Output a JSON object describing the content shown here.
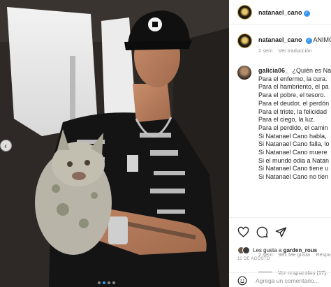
{
  "post": {
    "author": "natanael_cano",
    "verified_icon": "verified-check-icon",
    "caption_start": "ANIMO",
    "time_ago": "2 sem",
    "translate_label": "Ver traducción"
  },
  "carousel": {
    "prev_icon": "chevron-left-icon",
    "slide_count": 4,
    "active_slide": 2
  },
  "comment": {
    "username": "galicia06_",
    "lines": [
      "¿Quién es Nat",
      "Para el enfermo, la cura.",
      "Para el hambriento, el pa",
      "Para el pobre, el tesoro.",
      "Para el deudor, el perdón",
      "Para el triste, la felicidad",
      "Para el ciego, la luz.",
      "Para el perdido, el camin",
      "Si Natanael Cano habla,",
      "Si Natanael Cano falla, lo",
      "Si Natanael Cano muere",
      "Si el mundo odia a Natan",
      "Si Natanael Cano tiene u",
      "Si Natanael Cano no tien"
    ],
    "time_ago": "2 sem",
    "likes_label": "981 Me gusta",
    "reply_label": "Respo",
    "view_replies_label": "Ver respuestas (17)"
  },
  "actions": {
    "icons": [
      "heart-icon",
      "comment-icon",
      "share-icon"
    ],
    "liked_by_prefix": "Les gusta a ",
    "liked_by_user": "garden_rous",
    "date": "11 DE AGOSTO",
    "add_comment_placeholder": "Agrega un comentario..."
  },
  "colors": {
    "accent": "#3897f0",
    "text": "#262626",
    "muted": "#8e8e8e",
    "border": "#efefef"
  }
}
